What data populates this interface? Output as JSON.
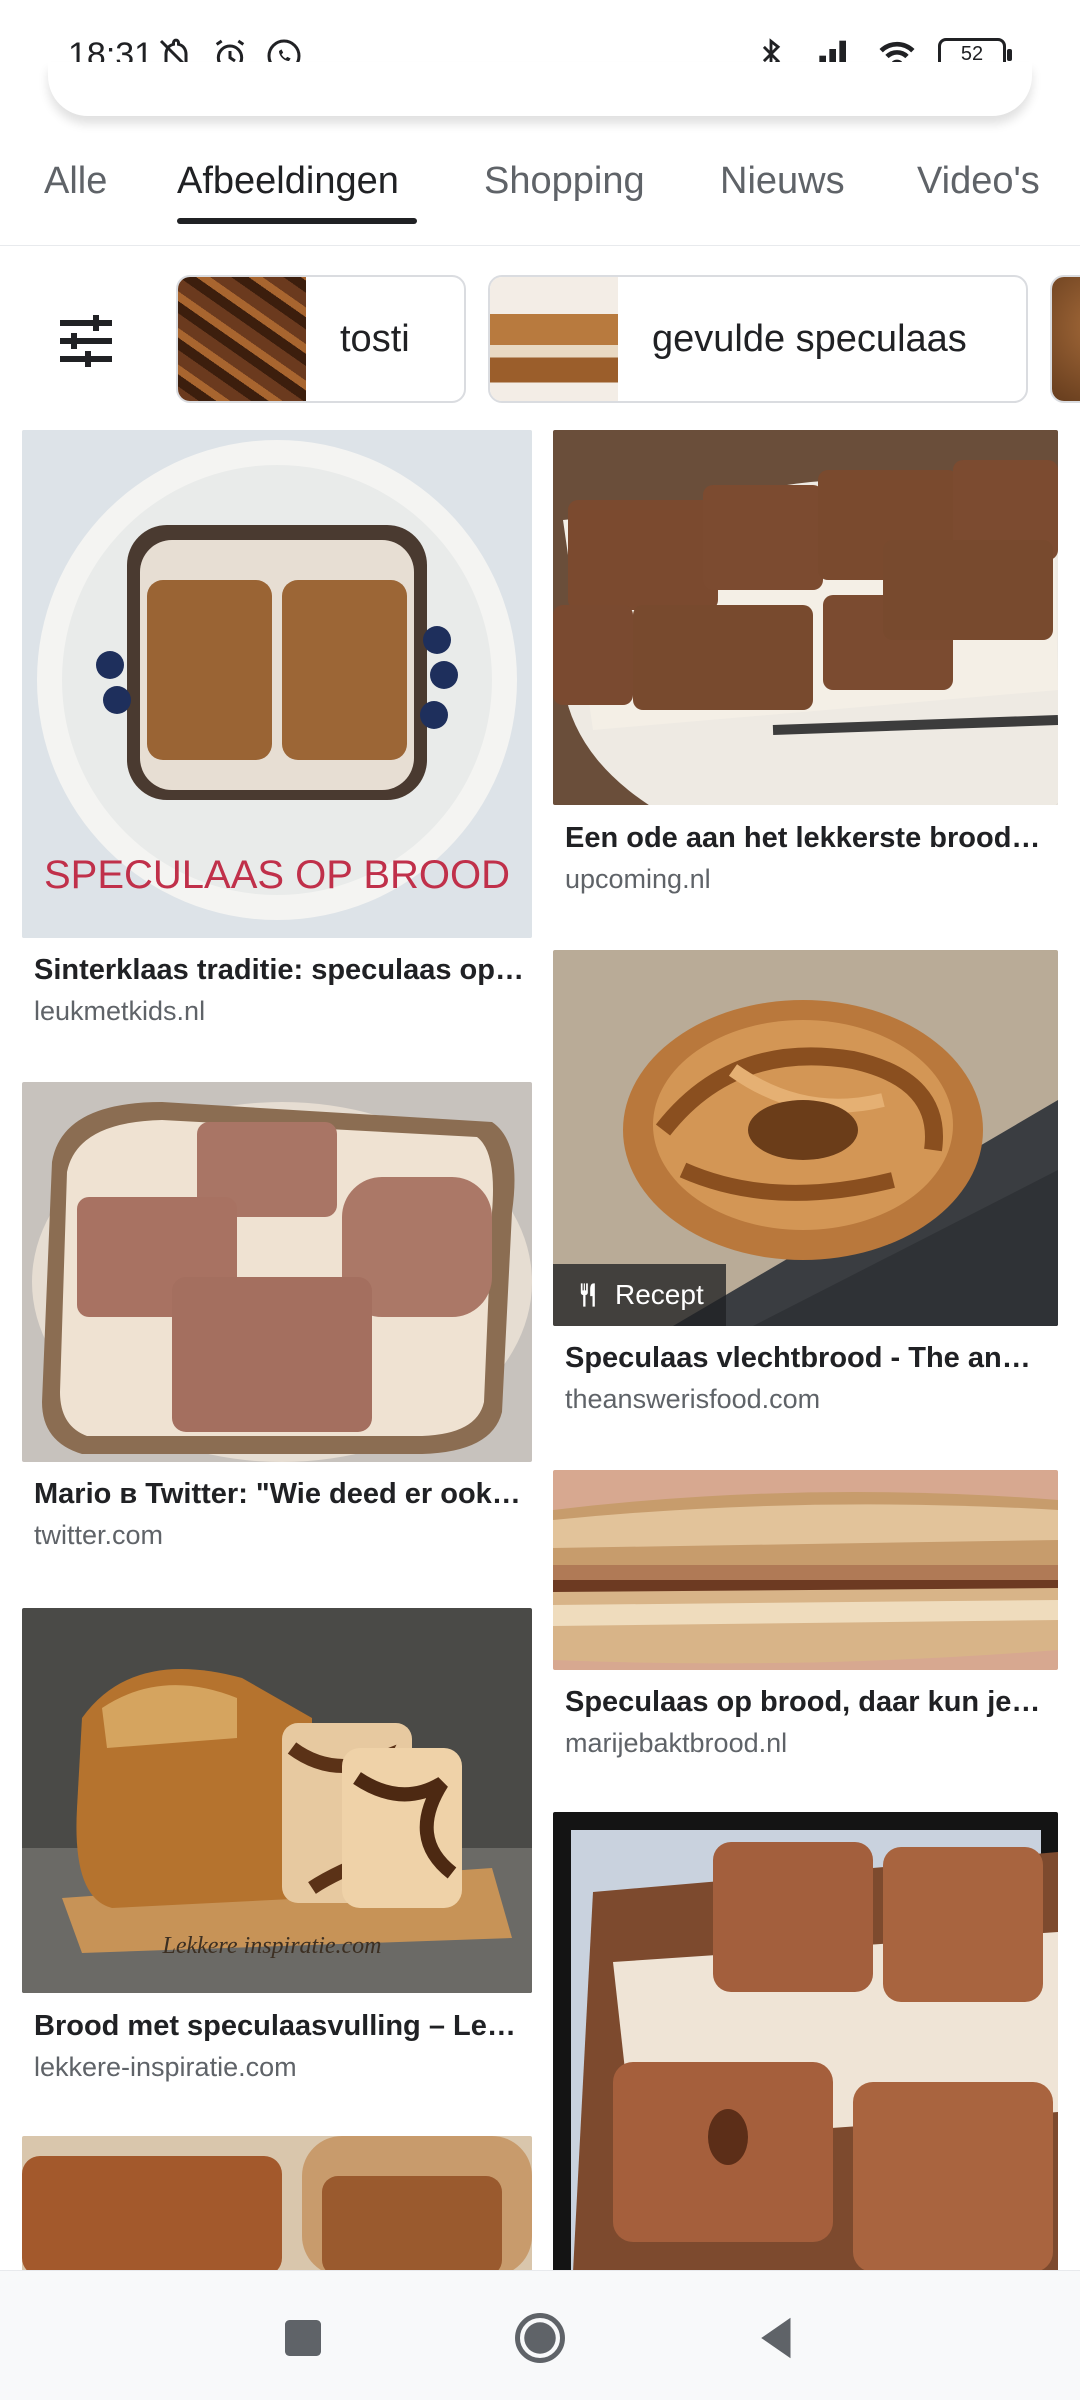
{
  "status": {
    "time": "18:31",
    "left_icons": [
      "bell-off-icon",
      "alarm-icon",
      "whatsapp-icon"
    ],
    "right_icons": [
      "bluetooth-icon",
      "signal-icon",
      "wifi-icon"
    ],
    "battery": "52"
  },
  "tabs": [
    {
      "label": "Alle",
      "active": false
    },
    {
      "label": "Afbeeldingen",
      "active": true
    },
    {
      "label": "Shopping",
      "active": false
    },
    {
      "label": "Nieuws",
      "active": false
    },
    {
      "label": "Video's",
      "active": false
    }
  ],
  "chips": [
    {
      "label": "tosti"
    },
    {
      "label": "gevulde speculaas"
    }
  ],
  "results": {
    "left": [
      {
        "title": "Sinterklaas traditie: speculaas op brood",
        "source": "leukmetkids.nl",
        "overlay_text": "SPECULAAS OP BROOD"
      },
      {
        "title": "Mario в Twitter: \"Wie deed er ook speculaas op brood?\"",
        "source": "twitter.com"
      },
      {
        "title": "Brood met speculaasvulling – Lekkere inspiratie",
        "source": "lekkere-inspiratie.com",
        "overlay_text": "Lekkere inspiratie.com"
      }
    ],
    "right": [
      {
        "title": "Een ode aan het lekkerste brood beleg",
        "source": "upcoming.nl"
      },
      {
        "title": "Speculaas vlechtbrood - The answer is food",
        "source": "theanswerisfood.com",
        "badge": "Recept"
      },
      {
        "title": "Speculaas op brood, daar kun je mee...",
        "source": "marijebaktbrood.nl"
      }
    ]
  },
  "nav": [
    "recents-icon",
    "home-icon",
    "back-icon"
  ]
}
